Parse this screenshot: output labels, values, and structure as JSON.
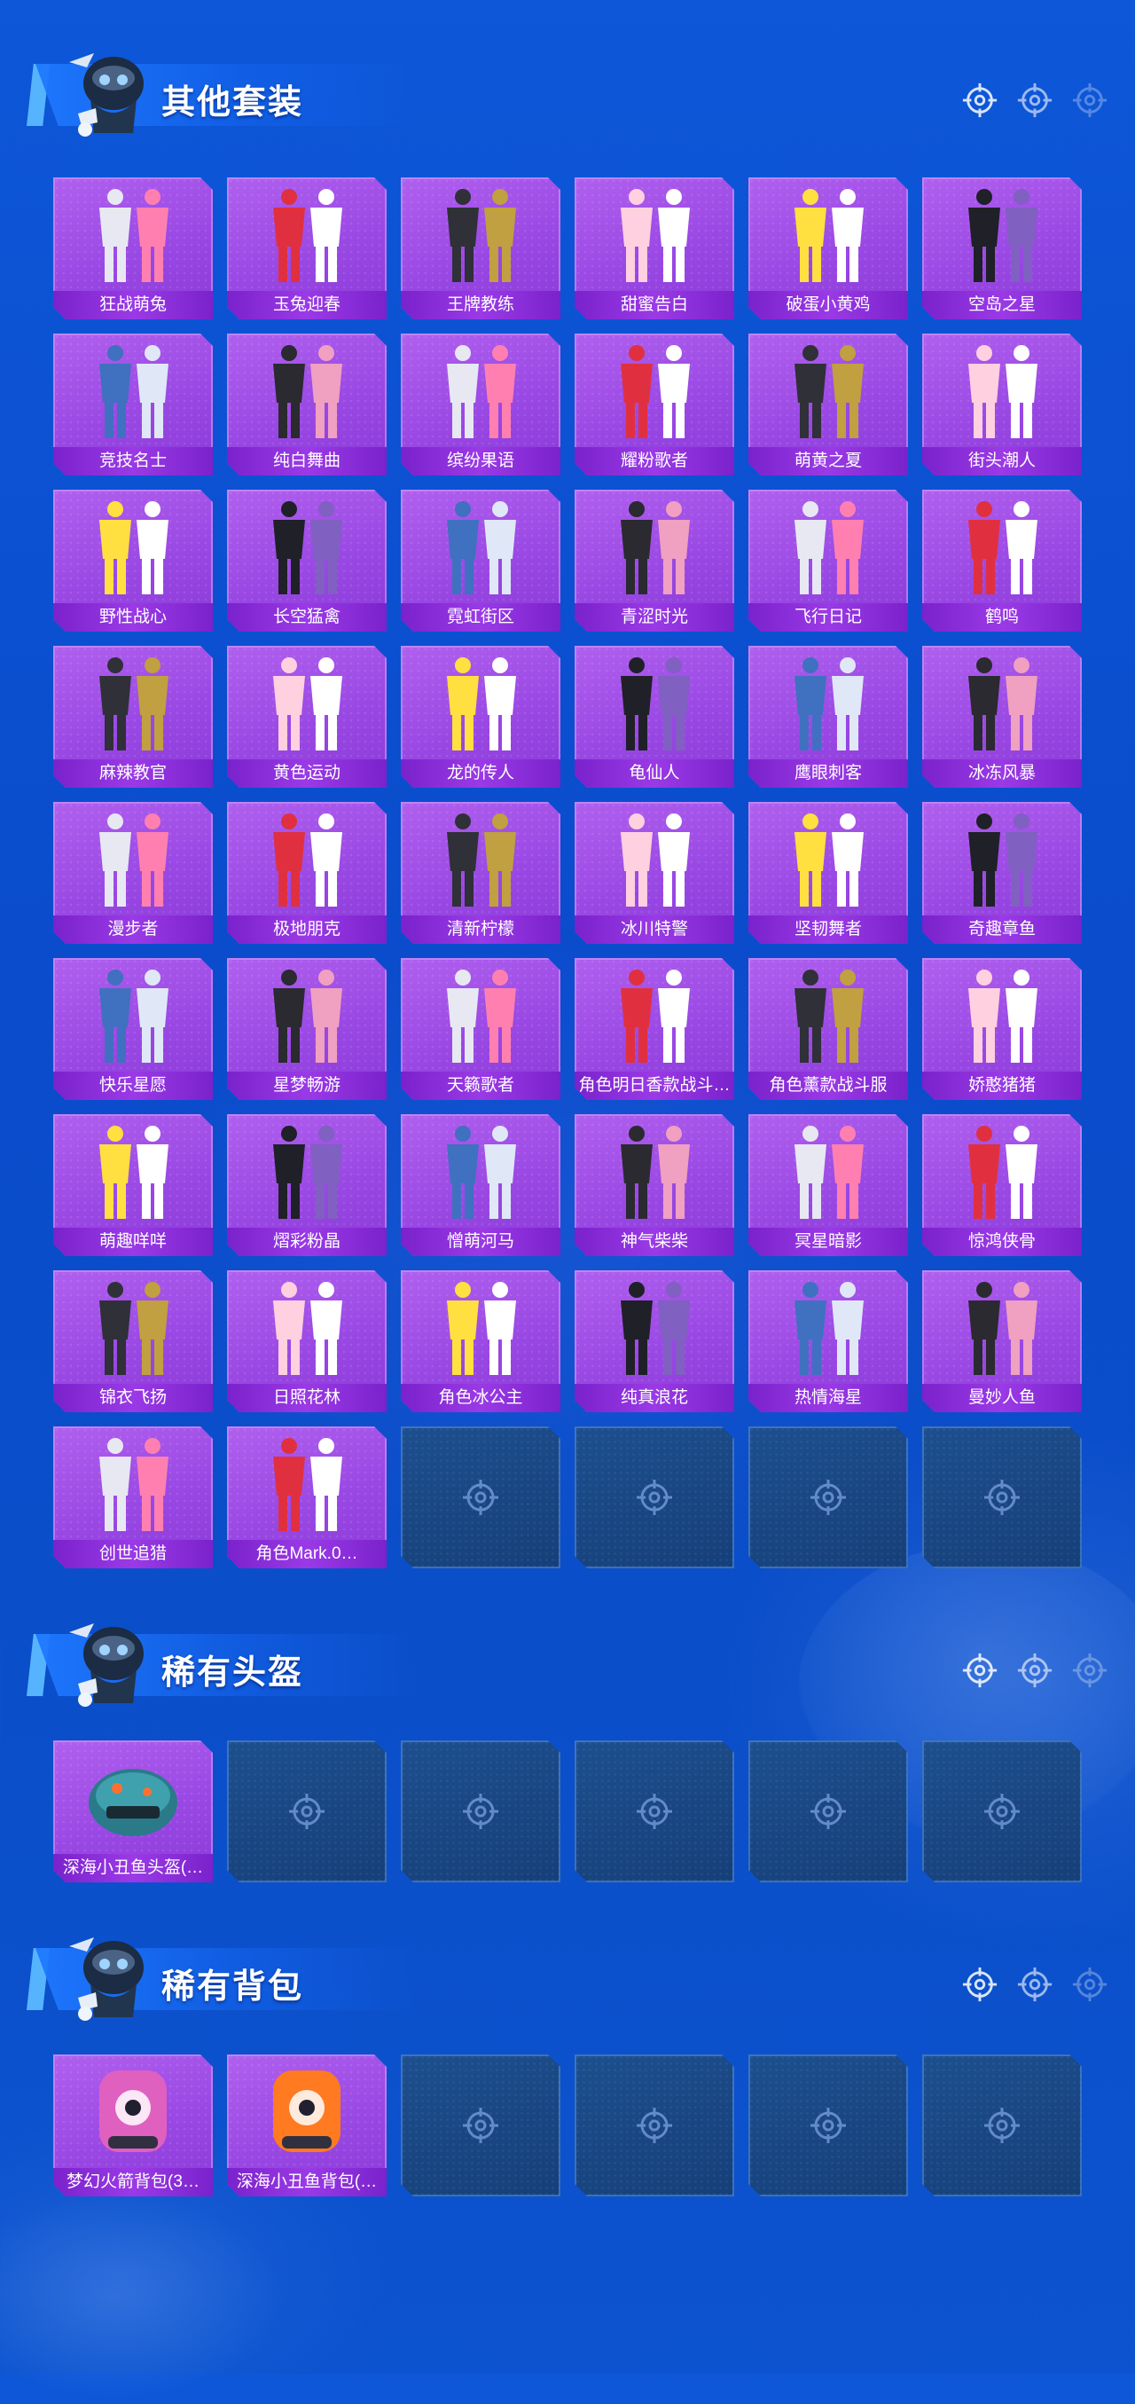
{
  "sections": [
    {
      "title": "其他套装",
      "items": [
        "狂战萌兔",
        "玉兔迎春",
        "王牌教练",
        "甜蜜告白",
        "破蛋小黄鸡",
        "空岛之星",
        "竞技名士",
        "纯白舞曲",
        "缤纷果语",
        "耀粉歌者",
        "萌黄之夏",
        "街头潮人",
        "野性战心",
        "长空猛禽",
        "霓虹街区",
        "青涩时光",
        "飞行日记",
        "鹤鸣",
        "麻辣教官",
        "黄色运动",
        "龙的传人",
        "龟仙人",
        "鹰眼刺客",
        "冰冻风暴",
        "漫步者",
        "极地朋克",
        "清新柠檬",
        "冰川特警",
        "坚韧舞者",
        "奇趣章鱼",
        "快乐星愿",
        "星梦畅游",
        "天籁歌者",
        "角色明日香款战斗…",
        "角色薰款战斗服",
        "娇憨猪猪",
        "萌趣咩咩",
        "熠彩粉晶",
        "憎萌河马",
        "神气柴柴",
        "冥星暗影",
        "惊鸿侠骨",
        "锦衣飞扬",
        "日照花林",
        "角色冰公主",
        "纯真浪花",
        "热情海星",
        "曼妙人鱼",
        "创世追猎",
        "角色Mark.0…"
      ],
      "empty_slots": 4
    },
    {
      "title": "稀有头盔",
      "items": [
        "深海小丑鱼头盔(…"
      ],
      "empty_slots": 5
    },
    {
      "title": "稀有背包",
      "items": [
        "梦幻火箭背包(3…",
        "深海小丑鱼背包(…"
      ],
      "empty_slots": 4
    }
  ],
  "colors": {
    "background": "#0b4ec9",
    "card_filled": "#9a48e4",
    "card_label": "#7a22cc",
    "card_empty": "#1d4f8e",
    "accent": "#56b4ff"
  },
  "icons": {
    "mascot": "soldier-mascot-icon",
    "target": "crosshair-target-icon",
    "outfit": "outfit-thumbnail",
    "helmet": "helmet-thumbnail",
    "backpack": "backpack-thumbnail"
  }
}
